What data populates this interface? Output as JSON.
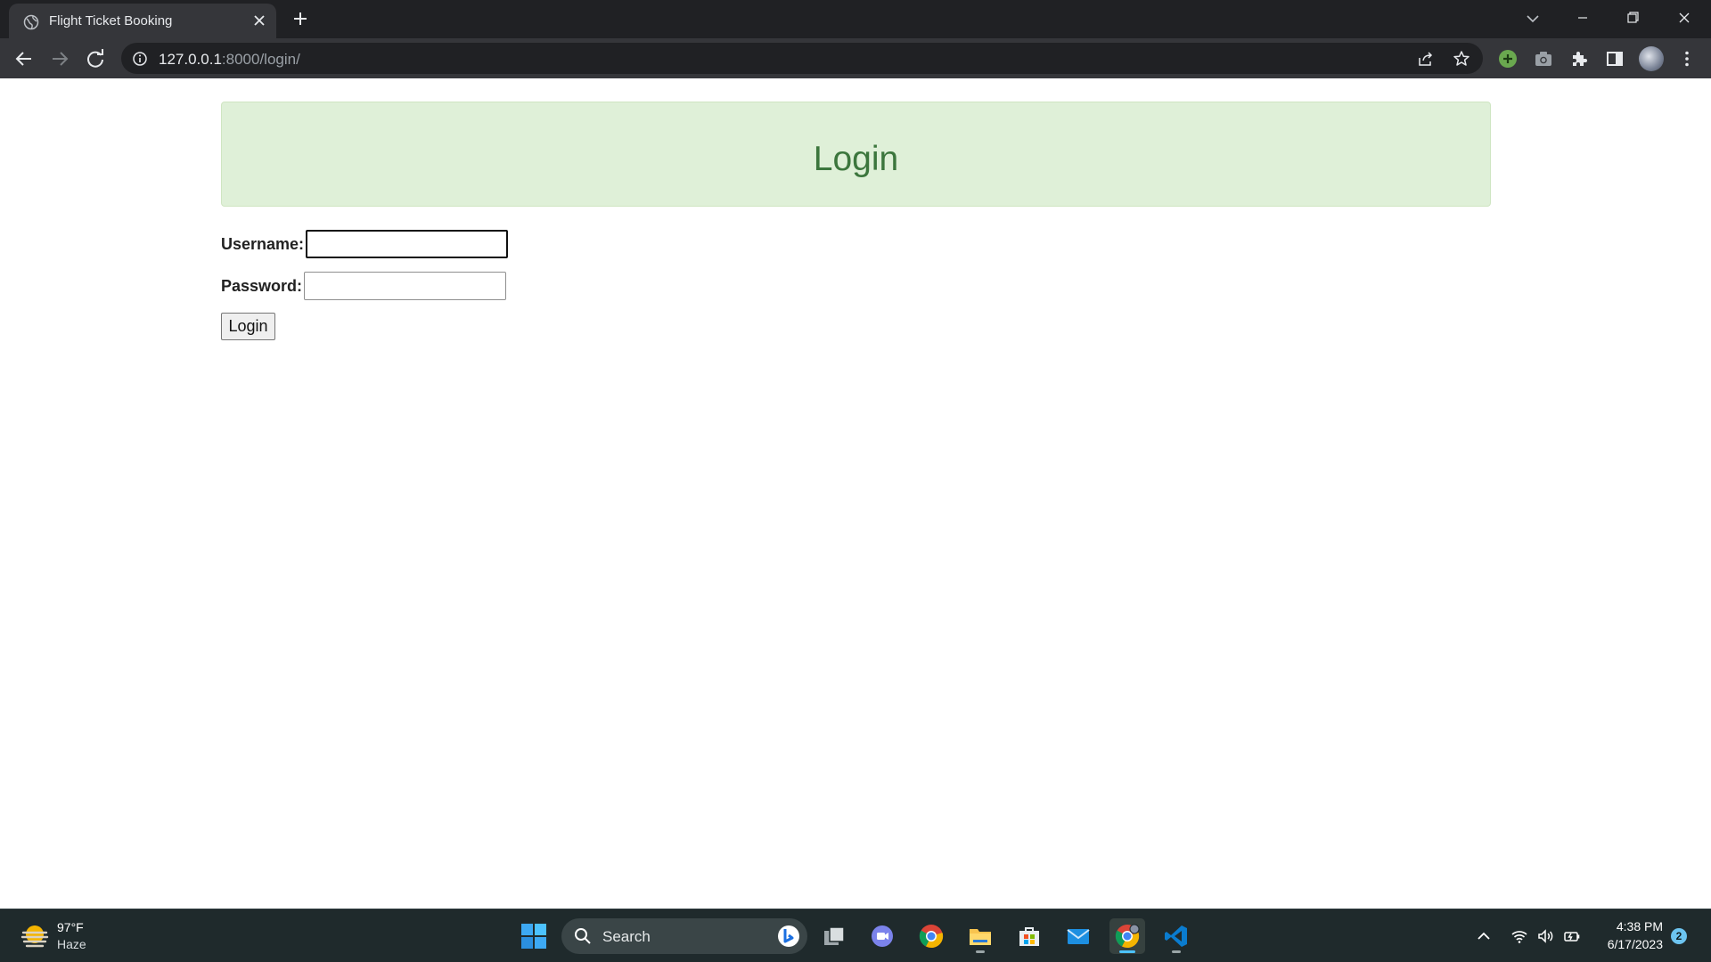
{
  "browser": {
    "tab_title": "Flight Ticket Booking",
    "url_host": "127.0.0.1",
    "url_path": ":8000/login/"
  },
  "page": {
    "banner_title": "Login",
    "username_label": "Username:",
    "username_value": "",
    "password_label": "Password:",
    "password_value": "",
    "submit_label": "Login",
    "banner_color": "#dff0d8",
    "banner_text_color": "#3c763d"
  },
  "taskbar": {
    "weather_temp": "97°F",
    "weather_condition": "Haze",
    "search_placeholder": "Search",
    "apps": [
      "start-icon",
      "teams-icon",
      "task-view-icon",
      "chrome-icon",
      "file-explorer-icon",
      "store-icon",
      "mail-icon",
      "chrome-icon",
      "vscode-icon"
    ],
    "clock_time": "4:38 PM",
    "clock_date": "6/17/2023",
    "notification_count": "2"
  }
}
